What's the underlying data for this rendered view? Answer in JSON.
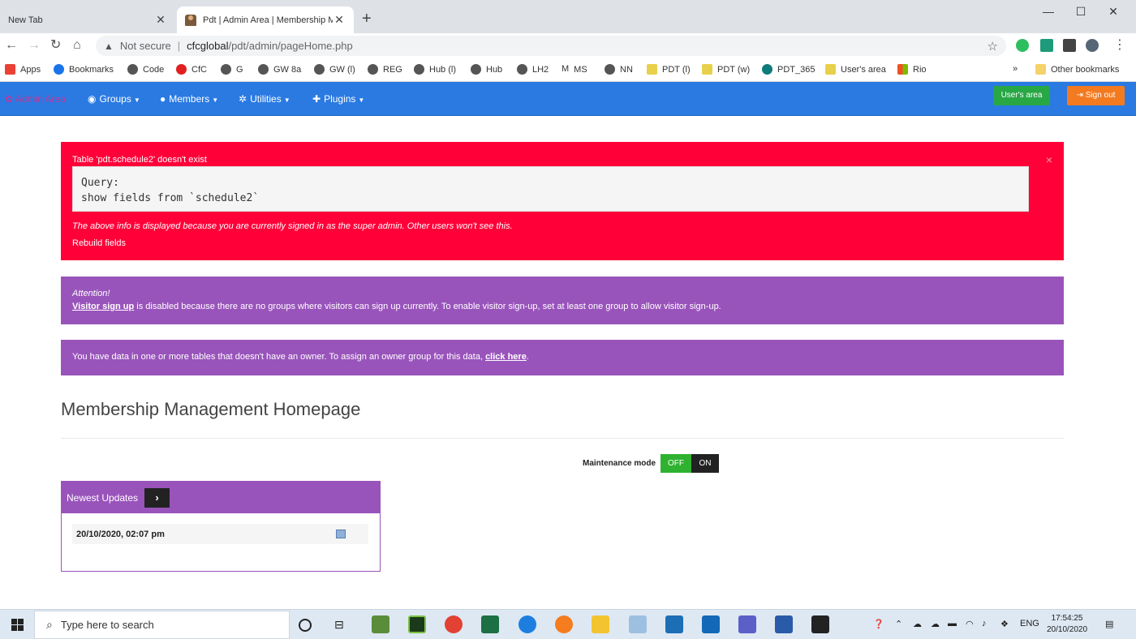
{
  "browser": {
    "tabs": [
      {
        "title": "New Tab"
      },
      {
        "title": "Pdt | Admin Area | Membership M"
      }
    ],
    "address": {
      "security_label": "Not secure",
      "host": "cfcglobal",
      "path": "/pdt/admin/pageHome.php"
    },
    "bookmarks": [
      "Apps",
      "Bookmarks",
      "Code",
      "CfC",
      "G",
      "GW 8a",
      "GW (l)",
      "REG",
      "Hub (l)",
      "Hub",
      "LH2",
      "MS",
      "NN",
      "PDT (l)",
      "PDT (w)",
      "PDT_365",
      "User's area",
      "Rio"
    ],
    "bookmarks_overflow": "»",
    "other_bookmarks": "Other bookmarks"
  },
  "navbar": {
    "brand": "Admin Area",
    "menus": [
      "Groups",
      "Members",
      "Utilities",
      "Plugins"
    ],
    "users_area": "User's area",
    "sign_out": "Sign out"
  },
  "error_alert": {
    "title": "Table 'pdt.schedule2' doesn't exist",
    "close": "×",
    "query_line1": "Query:",
    "query_line2": "show fields from `schedule2`",
    "note": "The above info is displayed because you are currently signed in as the super admin. Other users won't see this.",
    "link": "Rebuild fields"
  },
  "visitor_alert": {
    "attention": "Attention!",
    "link": "Visitor sign up",
    "text": " is disabled because there are no groups where visitors can sign up currently. To enable visitor sign-up, set at least one group to allow visitor sign-up."
  },
  "owner_alert": {
    "text": "You have data in one or more tables that doesn't have an owner. To assign an owner group for this data, ",
    "link": "click here",
    "suffix": "."
  },
  "page": {
    "title": "Membership Management Homepage",
    "maintenance_label": "Maintenance mode",
    "maintenance_off": "OFF",
    "maintenance_on": "ON"
  },
  "updates": {
    "header": "Newest Updates",
    "button": "›",
    "date": "20/10/2020, 02:07 pm"
  },
  "taskbar": {
    "search_placeholder": "Type here to search",
    "language": "ENG",
    "time": "17:54:25",
    "date": "20/10/2020"
  }
}
